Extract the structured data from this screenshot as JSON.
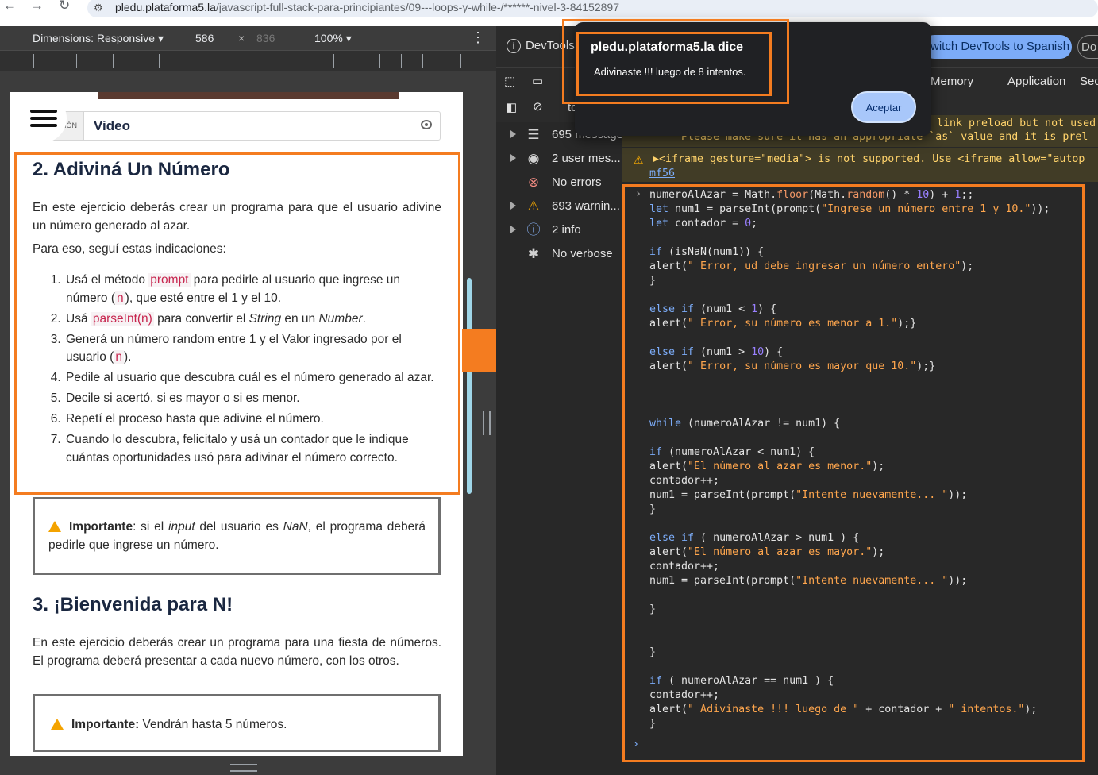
{
  "browser": {
    "url_host": "pledu.plataforma5.la",
    "url_path": "/javascript-full-stack-para-principiantes/09---loops-y-while-/******-nivel-3-84152897"
  },
  "emulation": {
    "dimensions_label": "Dimensions: Responsive ▾",
    "width": "586",
    "times": "×",
    "height": "836",
    "zoom": "100% ▾",
    "menu": "⋮"
  },
  "page": {
    "tab_prefix": "CIÓN",
    "tab_label": "Video",
    "section2_title": "2. Adiviná Un Número",
    "section2_intro": "En este ejercicio deberás crear un programa para que el usuario adivine un número generado al azar.",
    "section2_lead": "Para eso, seguí estas indicaciones:",
    "steps": {
      "s1_a": "Usá el método ",
      "s1_code": "prompt",
      "s1_b": " para pedirle al usuario que ingrese un número (",
      "s1_n": "n",
      "s1_c": "), que esté entre el 1 y el 10.",
      "s2_a": "Usá ",
      "s2_code": "parseInt(n)",
      "s2_b": " para convertir el ",
      "s2_i1": "String",
      "s2_c": " en un ",
      "s2_i2": "Number",
      "s2_d": ".",
      "s3_a": "Generá un número random entre 1 y el Valor ingresado por el usuario (",
      "s3_n": "n",
      "s3_b": ").",
      "s4": "Pedile al usuario que descubra cuál es el número generado al azar.",
      "s5": "Decile si acertó, si es mayor o si es menor.",
      "s6": "Repetí el proceso hasta que adivine el número.",
      "s7": "Cuando lo descubra, felicitalo y usá un contador que le indique cuántas oportunidades usó para adivinar el número correcto."
    },
    "warn1": {
      "bold": "Importante",
      "a": ": si el ",
      "i1": "input",
      "b": " del usuario es ",
      "i2": "NaN",
      "c": ", el programa deberá pedirle que ingrese un número."
    },
    "section3_title": "3. ¡Bienvenida para N!",
    "section3_intro": "En este ejercicio deberás crear un programa para una fiesta de números. El programa deberá presentar a cada nuevo número, con los otros.",
    "warn2": {
      "bold": "Importante:",
      "text": " Vendrán hasta 5 números."
    }
  },
  "devtools": {
    "title": "DevTools",
    "switch_label": "witch DevTools to Spanish",
    "do_label": "Do",
    "tabs": {
      "memory": "Memory",
      "application": "Application",
      "security": "Sec"
    },
    "toolbar_partial": "to",
    "sidebar": [
      {
        "label": "695 messages",
        "icon": "list-icon",
        "glyph": "☰"
      },
      {
        "label": "2 user mes...",
        "icon": "user-icon",
        "glyph": "◉"
      },
      {
        "label": "No errors",
        "icon": "error-icon",
        "glyph": "⊗"
      },
      {
        "label": "693 warnin...",
        "icon": "warning-icon",
        "glyph": "⚠"
      },
      {
        "label": "2 info",
        "icon": "info-icon",
        "glyph": "ⓘ"
      },
      {
        "label": "No verbose",
        "icon": "bug-icon",
        "glyph": "✱"
      }
    ],
    "warn_line1": "link preload but not used",
    "warn_line2": "Please make sure it has an appropriate `as` value and it is prel",
    "warn_iframe": "▶<iframe gesture=\"media\"> is not supported. Use <iframe allow=\"autop",
    "warn_link": "mf56",
    "prompt_glyph": "›"
  },
  "dialog": {
    "title": "pledu.plataforma5.la dice",
    "message": "Adivinaste !!! luego de 8 intentos.",
    "ok_label": "Aceptar"
  }
}
